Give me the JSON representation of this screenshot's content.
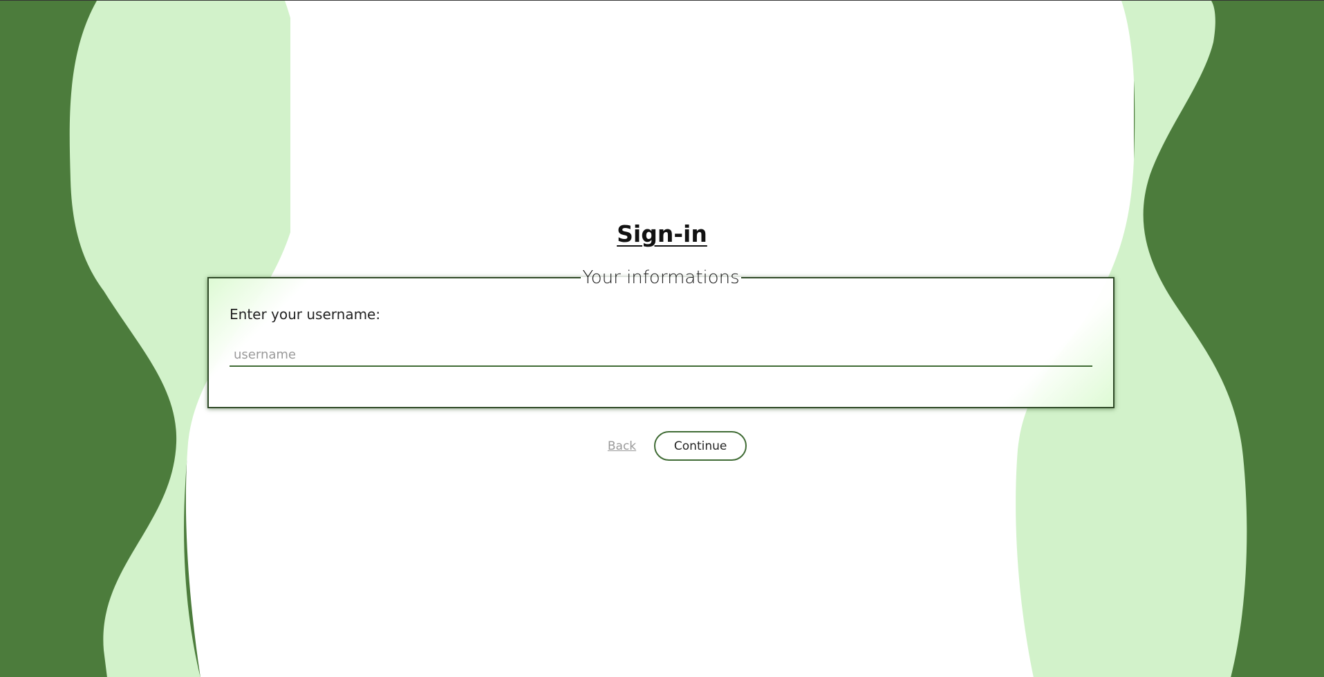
{
  "page": {
    "title": "Sign-in"
  },
  "form": {
    "legend": "Your informations",
    "username_label": "Enter your username:",
    "username_placeholder": "username",
    "username_value": ""
  },
  "actions": {
    "back_label": "Back",
    "continue_label": "Continue"
  },
  "colors": {
    "dark_green": "#4c7c3c",
    "light_green": "#d2f2ca",
    "accent": "#3f6b34"
  }
}
